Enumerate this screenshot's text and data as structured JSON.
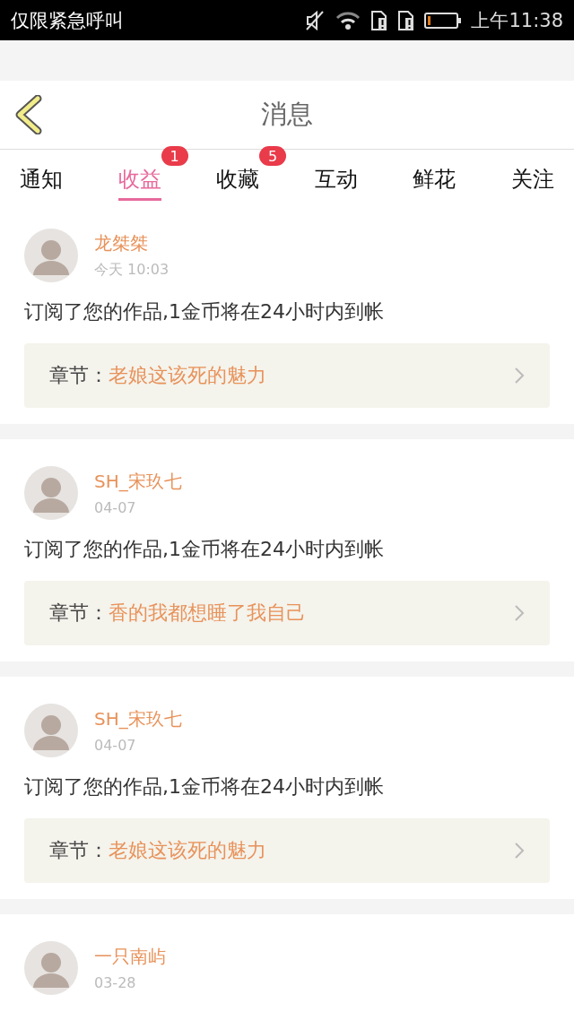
{
  "status_bar": {
    "carrier": "仅限紧急呼叫",
    "time": "上午11:38"
  },
  "header": {
    "title": "消息"
  },
  "tabs": [
    {
      "label": "通知",
      "selected": false
    },
    {
      "label": "收益",
      "selected": true,
      "badge": "1"
    },
    {
      "label": "收藏",
      "selected": false,
      "badge": "5"
    },
    {
      "label": "互动",
      "selected": false
    },
    {
      "label": "鲜花",
      "selected": false
    },
    {
      "label": "关注",
      "selected": false
    }
  ],
  "messages": [
    {
      "name": "龙桀桀",
      "time": "今天 10:03",
      "text": "订阅了您的作品,1金币将在24小时内到帐",
      "chapter_label": "章节：",
      "chapter": "老娘这该死的魅力"
    },
    {
      "name": "SH_宋玖七",
      "time": "04-07",
      "text": "订阅了您的作品,1金币将在24小时内到帐",
      "chapter_label": "章节：",
      "chapter": "香的我都想睡了我自己"
    },
    {
      "name": "SH_宋玖七",
      "time": "04-07",
      "text": "订阅了您的作品,1金币将在24小时内到帐",
      "chapter_label": "章节：",
      "chapter": "老娘这该死的魅力"
    },
    {
      "name": "一只南屿",
      "time": "03-28"
    }
  ]
}
